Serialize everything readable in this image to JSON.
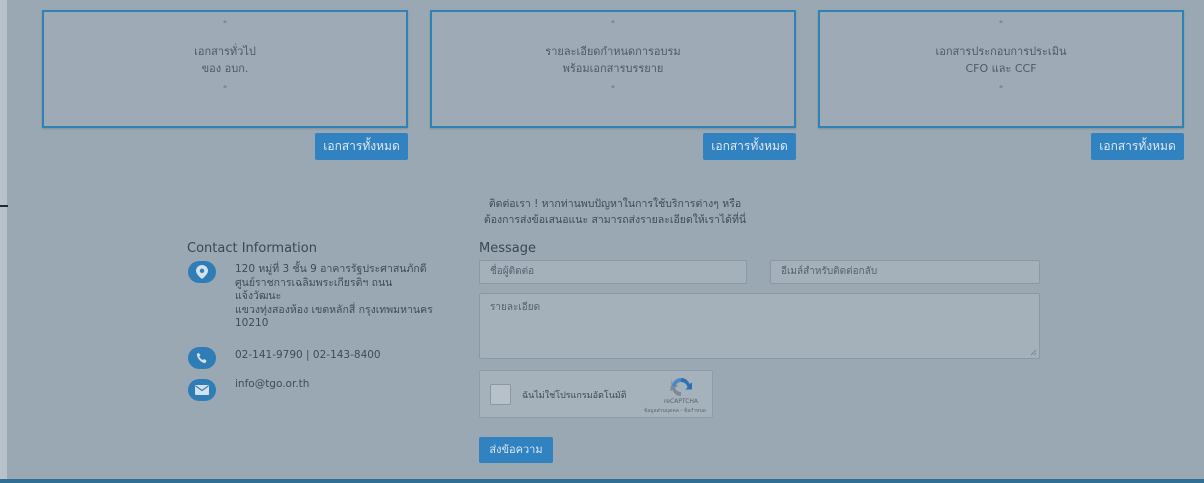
{
  "cards": [
    {
      "quote_top": "\"",
      "line1": "เอกสารทั่วไป",
      "line2": "ของ อบก.",
      "quote_bottom": "\""
    },
    {
      "quote_top": "\"",
      "line1": "รายละเอียดกำหนดการอบรม",
      "line2": "พร้อมเอกสารบรรยาย",
      "quote_bottom": "\""
    },
    {
      "quote_top": "\"",
      "line1": "เอกสารประกอบการประเมิน",
      "line2": "CFO และ CCF",
      "quote_bottom": "\""
    }
  ],
  "all_docs_label": "เอกสารทั้งหมด",
  "intro": {
    "line1": "ติดต่อเรา ! หากท่านพบปัญหาในการใช้บริการต่างๆ หรือ",
    "line2": "ต้องการส่งข้อเสนอแนะ สามารถส่งรายละเอียดให้เราได้ที่นี่"
  },
  "contact": {
    "title": "Contact Information",
    "address_lines": [
      "120 หมู่ที่ 3 ชั้น 9 อาคารรัฐประศาสนภักดี",
      "ศูนย์ราชการเฉลิมพระเกียรติฯ ถนน",
      "แจ้งวัฒนะ",
      "แขวงทุ่งสองห้อง เขตหลักสี่ กรุงเทพมหานคร",
      "10210"
    ],
    "phone": "02-141-9790 | 02-143-8400",
    "email": "info@tgo.or.th"
  },
  "message": {
    "title": "Message",
    "name_placeholder": "ชื่อผู้ติดต่อ",
    "email_placeholder": "อีเมล์สำหรับติดต่อกลับ",
    "detail_placeholder": "รายละเอียด",
    "captcha_label": "ฉันไม่ใช่โปรแกรมอัตโนมัติ",
    "captcha_brand": "reCAPTCHA",
    "captcha_terms": "ข้อมูลส่วนบุคคล - ข้อกำหนด",
    "send_label": "ส่งข้อความ"
  },
  "colors": {
    "accent": "#3182c0",
    "card_border": "#2f82b4",
    "overlay_bg": "#9aa8b3"
  }
}
